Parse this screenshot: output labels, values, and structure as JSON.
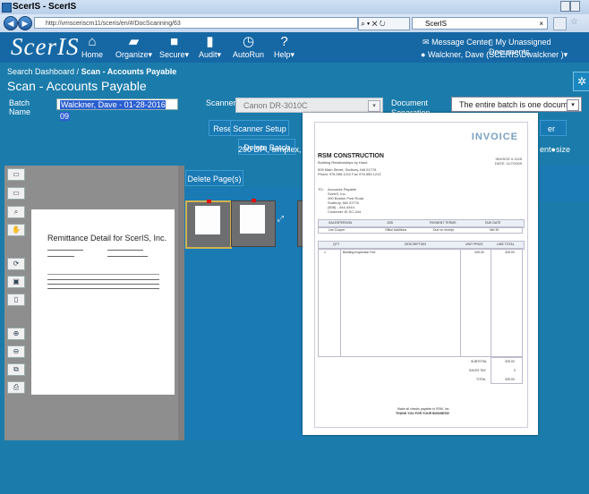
{
  "window": {
    "title": "ScerIS - ScerIS"
  },
  "browser": {
    "url": "http://vmsceriscm11/sceris/en/#/DocScanning/63",
    "tab_title": "ScerIS",
    "back_icon": "back-arrow-icon",
    "forward_icon": "forward-arrow-icon"
  },
  "app": {
    "logo": "ScerIS",
    "nav": [
      {
        "label": "Home",
        "icon": "home-icon"
      },
      {
        "label": "Organize",
        "icon": "folder-icon"
      },
      {
        "label": "Secure",
        "icon": "lock-icon"
      },
      {
        "label": "Audit",
        "icon": "document-icon"
      },
      {
        "label": "AutoRun",
        "icon": "clock-icon"
      },
      {
        "label": "Help",
        "icon": "question-icon"
      }
    ],
    "message_center": "Message Center",
    "unassigned_documents": "My Unassigned Documents",
    "user": "Walckner, Dave (SCERIS\\Dwalckner )"
  },
  "page": {
    "breadcrumb_root": "Search Dashboard /",
    "breadcrumb_current": "Scan - Accounts Payable",
    "title": "Scan - Accounts Payable"
  },
  "form": {
    "batch_label": "Batch Name",
    "batch_value": "Walckner, Dave - 01-28-2016 09",
    "scanner_label": "Scanner",
    "scanner_value": "Canon DR-3010C",
    "docsep_label": "Document Separation",
    "docsep_value": "The entire batch is one document",
    "reset": "Reset",
    "scanner_setup": "Scanner Setup",
    "delete_batch": "Delete Batch",
    "scan_info": "200 DPI, simplex, no d",
    "front_size": "ent",
    "size_label": "size",
    "after_label": "er"
  },
  "pages": {
    "delete_pages": "Delete Page(s)"
  },
  "preview": {
    "title": "Remittance Detail for ScerIS, Inc."
  },
  "invoice": {
    "title": "INVOICE",
    "company": "RSM CONSTRUCTION",
    "tagline": "Building Relationships by Hand",
    "address": "505 Main Street, Sudbury, MA 01776",
    "phone": "Phone 978.555.1212  Fax 978.555.1213",
    "invoice_no": "INVOICE # 1125",
    "date": "DATE: 11/7/2009",
    "to_label": "TO:",
    "to_lines": [
      "Accounts Payable",
      "ScerIS, Inc.",
      "490 Boston Post Road",
      "Sudbury, MA 01776",
      "(508) - 444-4444",
      "Customer ID SC-444"
    ],
    "terms_headers": [
      "SALESPERSON",
      "JOB",
      "PAYMENT TERMS",
      "DUE DATE"
    ],
    "terms_values": [
      "Lee Cooper",
      "Office Additions",
      "Due on receipt",
      "Net 30"
    ],
    "item_headers": [
      "QTY",
      "DESCRIPTION",
      "UNIT PRICE",
      "LINE TOTAL"
    ],
    "item_row": [
      "1",
      "Building Inspection Fee",
      "325.00",
      "325.00"
    ],
    "subtotal_label": "SUBTOTAL",
    "subtotal": "325.00",
    "tax_label": "SALES TAX",
    "tax": "0",
    "total_label": "TOTAL",
    "total": "325.00",
    "footer1": "Make all checks payable to RSM, Inc.",
    "footer2": "THANK YOU FOR YOUR BUSINESS!"
  },
  "colors": {
    "background": "#1b7cab",
    "header": "#1668a5",
    "accent": "#d11111"
  }
}
